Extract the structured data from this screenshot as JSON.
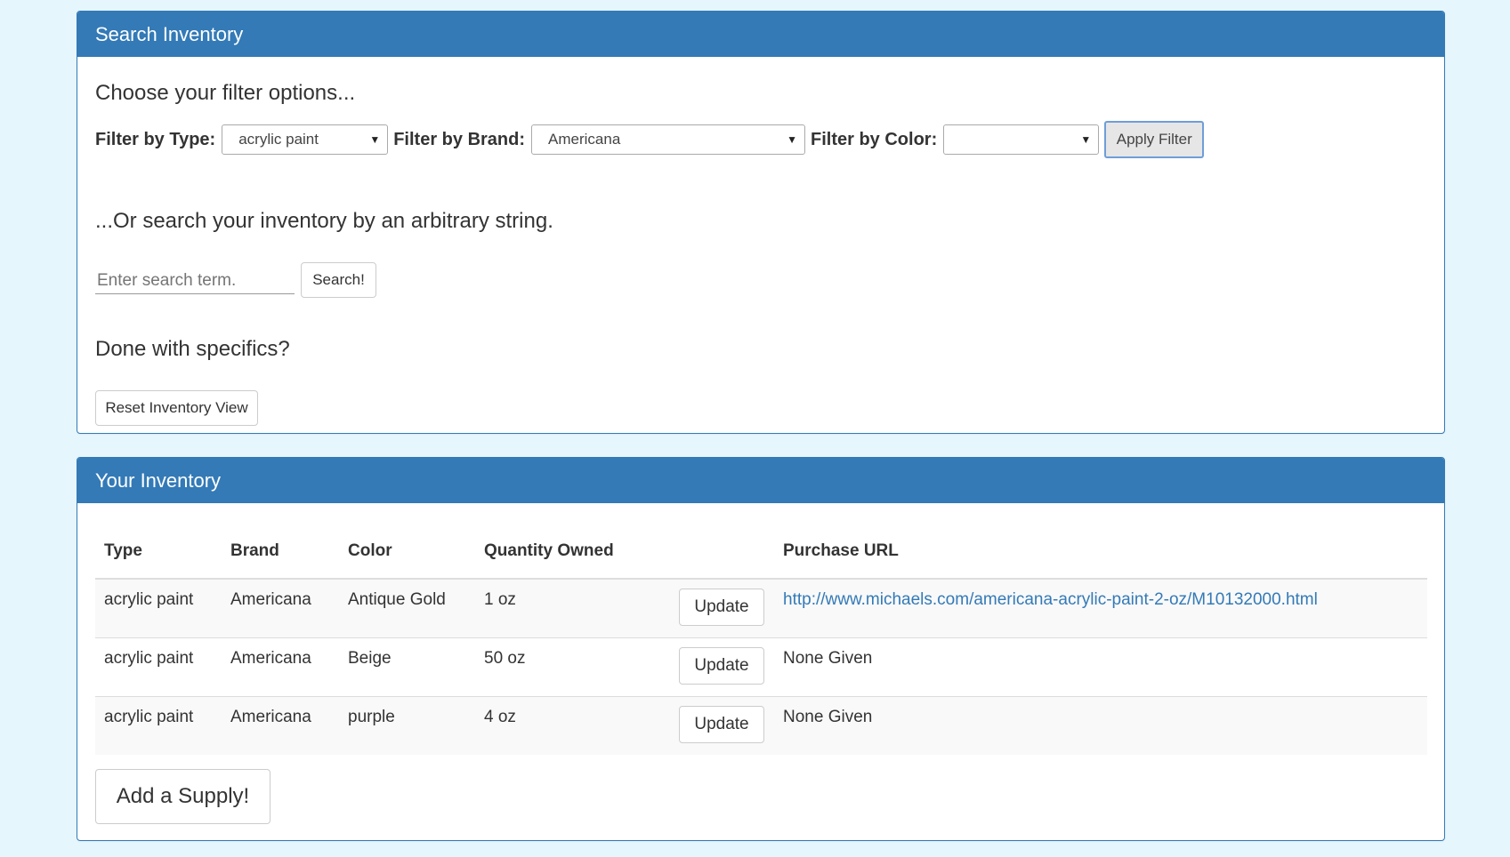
{
  "search_panel": {
    "title": "Search Inventory",
    "filter_heading": "Choose your filter options...",
    "filters": {
      "type_label": "Filter by Type:",
      "type_value": "acrylic paint",
      "brand_label": "Filter by Brand:",
      "brand_value": "Americana",
      "color_label": "Filter by Color:",
      "color_value": "",
      "apply_label": "Apply Filter"
    },
    "search_heading": "...Or search your inventory by an arbitrary string.",
    "search_placeholder": "Enter search term.",
    "search_button": "Search!",
    "reset_heading": "Done with specifics?",
    "reset_button": "Reset Inventory View"
  },
  "inventory_panel": {
    "title": "Your Inventory",
    "columns": [
      "Type",
      "Brand",
      "Color",
      "Quantity Owned",
      "",
      "Purchase URL"
    ],
    "rows": [
      {
        "type": "acrylic paint",
        "brand": "Americana",
        "color": "Antique Gold",
        "quantity": "1 oz",
        "action": "Update",
        "url": "http://www.michaels.com/americana-acrylic-paint-2-oz/M10132000.html"
      },
      {
        "type": "acrylic paint",
        "brand": "Americana",
        "color": "Beige",
        "quantity": "50 oz",
        "action": "Update",
        "url": "None Given"
      },
      {
        "type": "acrylic paint",
        "brand": "Americana",
        "color": "purple",
        "quantity": "4 oz",
        "action": "Update",
        "url": "None Given"
      }
    ],
    "add_button": "Add a Supply!"
  },
  "colors": {
    "page_background": "#e6f6fd",
    "panel_header": "#337ab7",
    "link": "#337ab7",
    "striped_row": "#f9f9f9"
  },
  "icons": {
    "select_caret": "caret-down-icon"
  }
}
